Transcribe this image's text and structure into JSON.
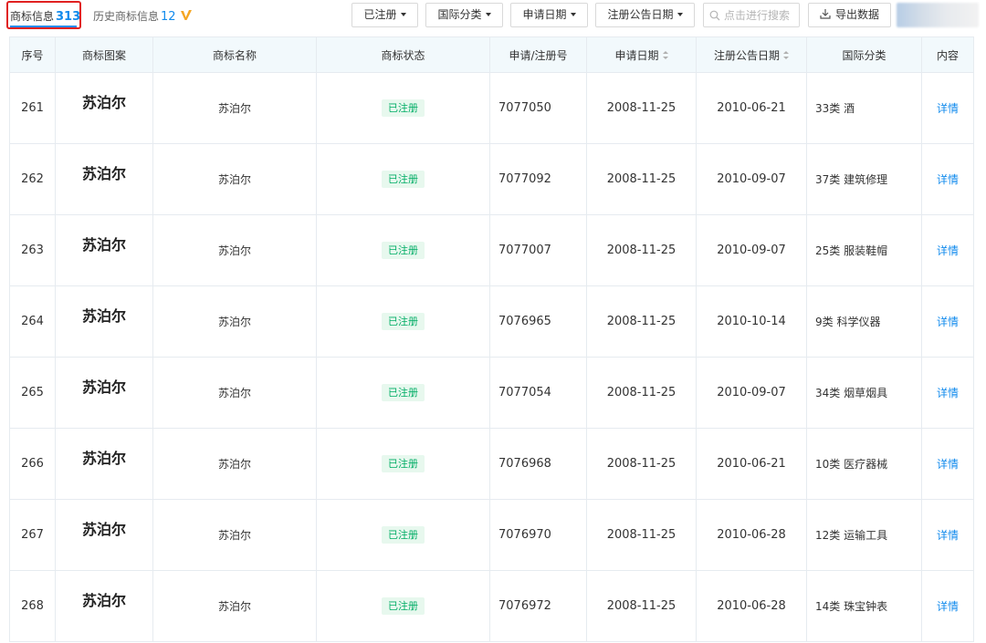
{
  "tabs": {
    "current_label": "商标信息",
    "current_count": "313",
    "history_label": "历史商标信息",
    "history_count": "12"
  },
  "filters": {
    "status_label": "已注册",
    "class_label": "国际分类",
    "app_date_label": "申请日期",
    "pub_date_label": "注册公告日期"
  },
  "search": {
    "placeholder": "点击进行搜索"
  },
  "export_label": "导出数据",
  "colors": {
    "accent": "#128bed",
    "status_green": "#00ad65",
    "highlight_red": "#e02020"
  },
  "table": {
    "headers": {
      "index": "序号",
      "image": "商标图案",
      "name": "商标名称",
      "status": "商标状态",
      "reg_no": "申请/注册号",
      "app_date": "申请日期",
      "pub_date": "注册公告日期",
      "intl_class": "国际分类",
      "content": "内容"
    },
    "rows": [
      {
        "index": "261",
        "image_text": "苏泊尔",
        "name": "苏泊尔",
        "status": "已注册",
        "reg_no": "7077050",
        "app_date": "2008-11-25",
        "pub_date": "2010-06-21",
        "intl_class": "33类 酒",
        "action": "详情"
      },
      {
        "index": "262",
        "image_text": "苏泊尔",
        "name": "苏泊尔",
        "status": "已注册",
        "reg_no": "7077092",
        "app_date": "2008-11-25",
        "pub_date": "2010-09-07",
        "intl_class": "37类 建筑修理",
        "action": "详情"
      },
      {
        "index": "263",
        "image_text": "苏泊尔",
        "name": "苏泊尔",
        "status": "已注册",
        "reg_no": "7077007",
        "app_date": "2008-11-25",
        "pub_date": "2010-09-07",
        "intl_class": "25类 服装鞋帽",
        "action": "详情"
      },
      {
        "index": "264",
        "image_text": "苏泊尔",
        "name": "苏泊尔",
        "status": "已注册",
        "reg_no": "7076965",
        "app_date": "2008-11-25",
        "pub_date": "2010-10-14",
        "intl_class": "9类 科学仪器",
        "action": "详情"
      },
      {
        "index": "265",
        "image_text": "苏泊尔",
        "name": "苏泊尔",
        "status": "已注册",
        "reg_no": "7077054",
        "app_date": "2008-11-25",
        "pub_date": "2010-09-07",
        "intl_class": "34类 烟草烟具",
        "action": "详情"
      },
      {
        "index": "266",
        "image_text": "苏泊尔",
        "name": "苏泊尔",
        "status": "已注册",
        "reg_no": "7076968",
        "app_date": "2008-11-25",
        "pub_date": "2010-06-21",
        "intl_class": "10类 医疗器械",
        "action": "详情"
      },
      {
        "index": "267",
        "image_text": "苏泊尔",
        "name": "苏泊尔",
        "status": "已注册",
        "reg_no": "7076970",
        "app_date": "2008-11-25",
        "pub_date": "2010-06-28",
        "intl_class": "12类 运输工具",
        "action": "详情"
      },
      {
        "index": "268",
        "image_text": "苏泊尔",
        "name": "苏泊尔",
        "status": "已注册",
        "reg_no": "7076972",
        "app_date": "2008-11-25",
        "pub_date": "2010-06-28",
        "intl_class": "14类 珠宝钟表",
        "action": "详情"
      }
    ]
  }
}
